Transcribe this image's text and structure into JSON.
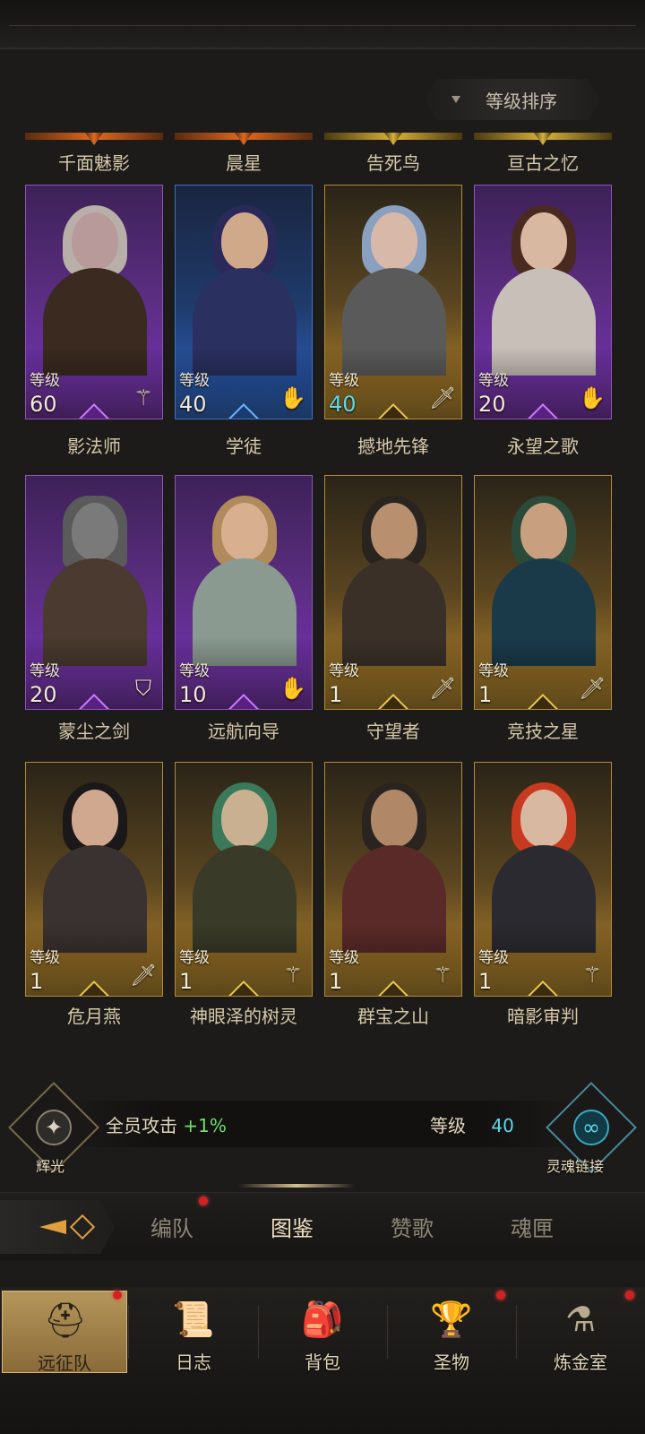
{
  "sort": {
    "label": "等级排序"
  },
  "top_row_names": [
    "千面魅影",
    "晨星",
    "告死鸟",
    "亘古之忆"
  ],
  "heroes": [
    {
      "name": "影法师",
      "level_label": "等级",
      "level": "60",
      "class_icon": "staff-icon"
    },
    {
      "name": "学徒",
      "level_label": "等级",
      "level": "40",
      "class_icon": "hand-icon"
    },
    {
      "name": "撼地先锋",
      "level_label": "等级",
      "level": "40",
      "class_icon": "sword-icon"
    },
    {
      "name": "永望之歌",
      "level_label": "等级",
      "level": "20",
      "class_icon": "hand-icon"
    },
    {
      "name": "蒙尘之剑",
      "level_label": "等级",
      "level": "20",
      "class_icon": "shield-icon"
    },
    {
      "name": "远航向导",
      "level_label": "等级",
      "level": "10",
      "class_icon": "hand-icon"
    },
    {
      "name": "守望者",
      "level_label": "等级",
      "level": "1",
      "class_icon": "sword-icon"
    },
    {
      "name": "竞技之星",
      "level_label": "等级",
      "level": "1",
      "class_icon": "sword-icon"
    },
    {
      "name": "危月燕",
      "level_label": "等级",
      "level": "1",
      "class_icon": "sword-icon"
    },
    {
      "name": "神眼泽的树灵",
      "level_label": "等级",
      "level": "1",
      "class_icon": "staff-icon"
    },
    {
      "name": "群宝之山",
      "level_label": "等级",
      "level": "1",
      "class_icon": "staff-icon"
    },
    {
      "name": "暗影审判",
      "level_label": "等级",
      "level": "1",
      "class_icon": "staff-icon"
    }
  ],
  "bonus": {
    "badge_left_caption": "辉光",
    "text": "全员攻击",
    "percent": "+1%",
    "link_label": "等级",
    "link_value": "40",
    "badge_right_caption": "灵魂链接"
  },
  "sub_tabs": [
    "编队",
    "图鉴",
    "赞歌",
    "魂匣"
  ],
  "bottom_nav": [
    "远征队",
    "日志",
    "背包",
    "圣物",
    "炼金室"
  ],
  "colors": {
    "accent_gold": "#b5965a",
    "cyan": "#5fd8e8",
    "green": "#6fe06a",
    "notification_red": "#d42020"
  }
}
